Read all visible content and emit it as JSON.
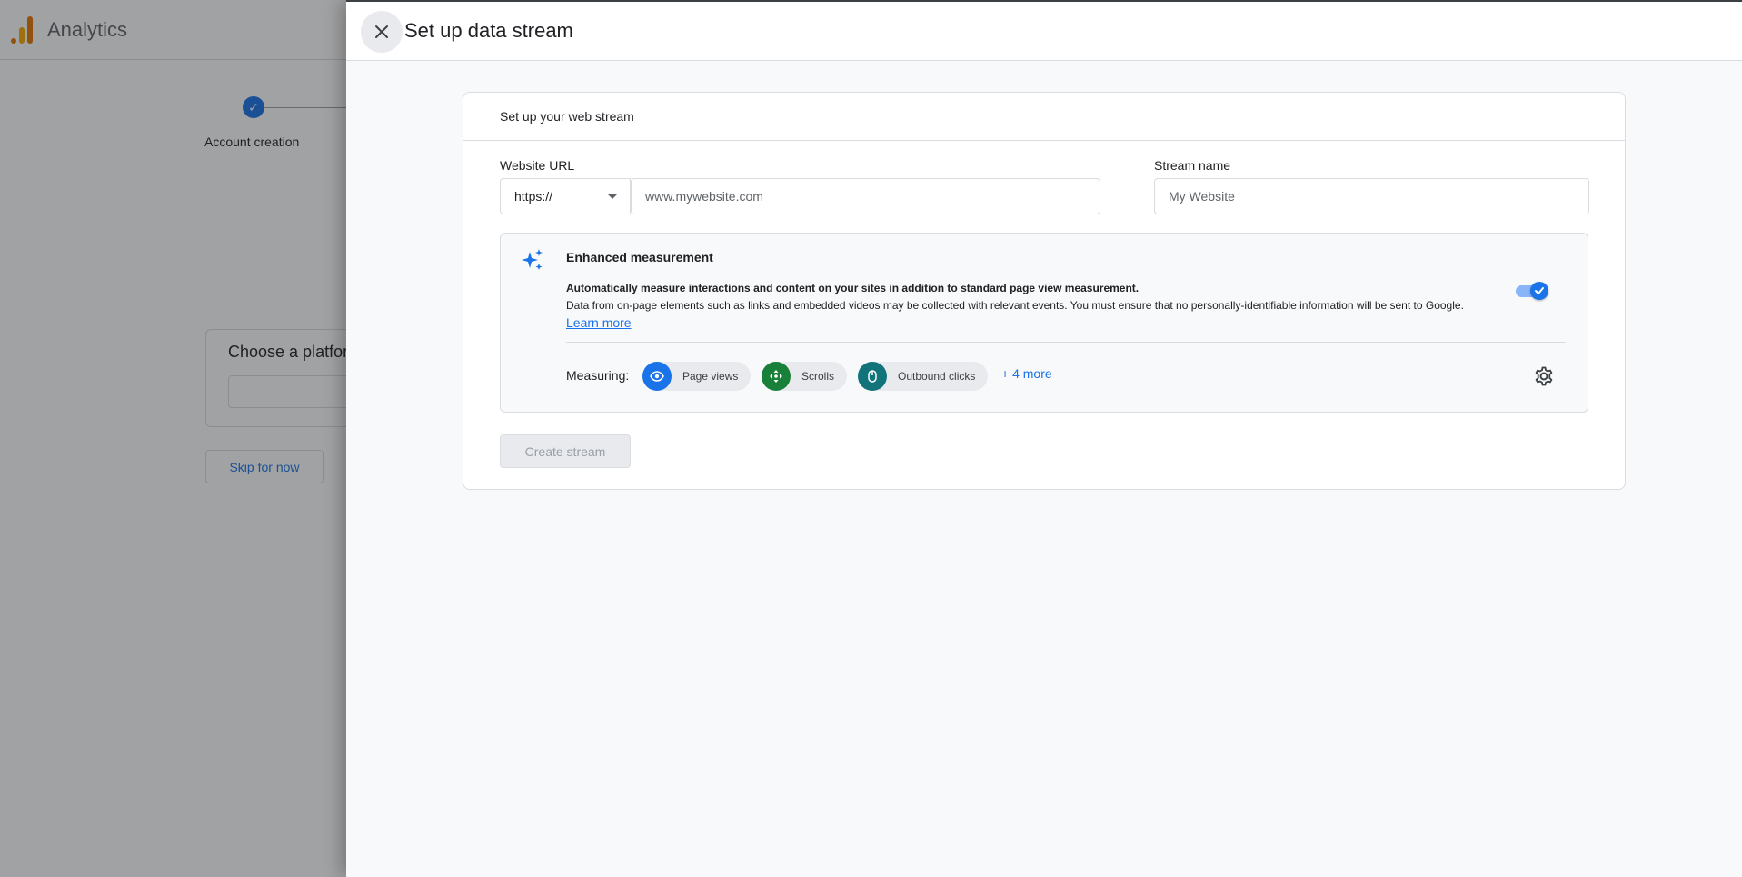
{
  "background": {
    "app_title": "Analytics",
    "step_label": "Account creation",
    "card_title": "Choose a platform",
    "skip_label": "Skip for now"
  },
  "drawer": {
    "title": "Set up data stream",
    "panel_title": "Set up your web stream",
    "website_url": {
      "label": "Website URL",
      "protocol": "https://",
      "placeholder": "www.mywebsite.com"
    },
    "stream_name": {
      "label": "Stream name",
      "placeholder": "My Website"
    },
    "enhanced_measurement": {
      "title": "Enhanced measurement",
      "desc_bold": "Automatically measure interactions and content on your sites in addition to standard page view measurement.",
      "desc": "Data from on-page elements such as links and embedded videos may be collected with relevant events. You must ensure that no personally-identifiable information will be sent to Google.",
      "learn_more": "Learn more",
      "enabled": true,
      "measuring_label": "Measuring:",
      "chips": [
        {
          "label": "Page views",
          "icon": "eye-icon",
          "color": "#1a73e8"
        },
        {
          "label": "Scrolls",
          "icon": "scroll-icon",
          "color": "#188038"
        },
        {
          "label": "Outbound clicks",
          "icon": "mouse-icon",
          "color": "#12737a"
        }
      ],
      "more": "+ 4 more"
    },
    "create_button": "Create stream"
  },
  "colors": {
    "accent": "#1a73e8",
    "logo_orange": "#e37400",
    "logo_yellow": "#f9ab00"
  }
}
